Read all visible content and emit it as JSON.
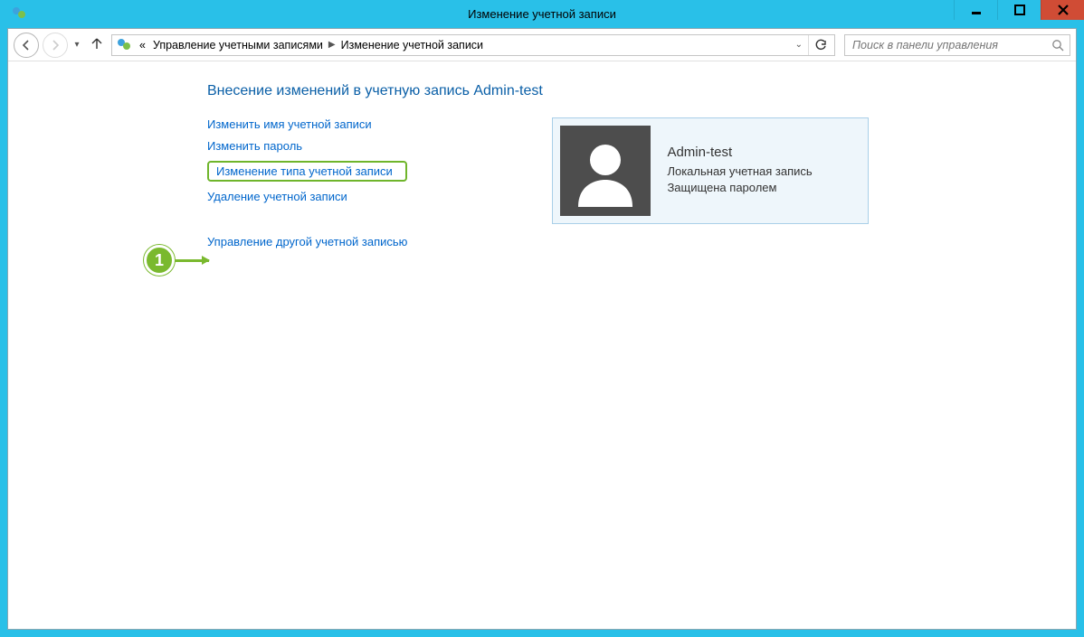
{
  "window": {
    "title": "Изменение учетной записи"
  },
  "nav": {
    "breadcrumb_prefix": "«",
    "breadcrumb_1": "Управление учетными записями",
    "breadcrumb_2": "Изменение учетной записи"
  },
  "search": {
    "placeholder": "Поиск в панели управления"
  },
  "main": {
    "heading": "Внесение изменений в учетную запись Admin-test",
    "links": {
      "rename": "Изменить имя учетной записи",
      "change_password": "Изменить пароль",
      "change_type": "Изменение типа учетной записи",
      "delete": "Удаление учетной записи",
      "manage_other": "Управление другой учетной записью"
    },
    "account": {
      "name": "Admin-test",
      "type": "Локальная учетная запись",
      "protected": "Защищена паролем"
    }
  },
  "annotation": {
    "step": "1"
  }
}
